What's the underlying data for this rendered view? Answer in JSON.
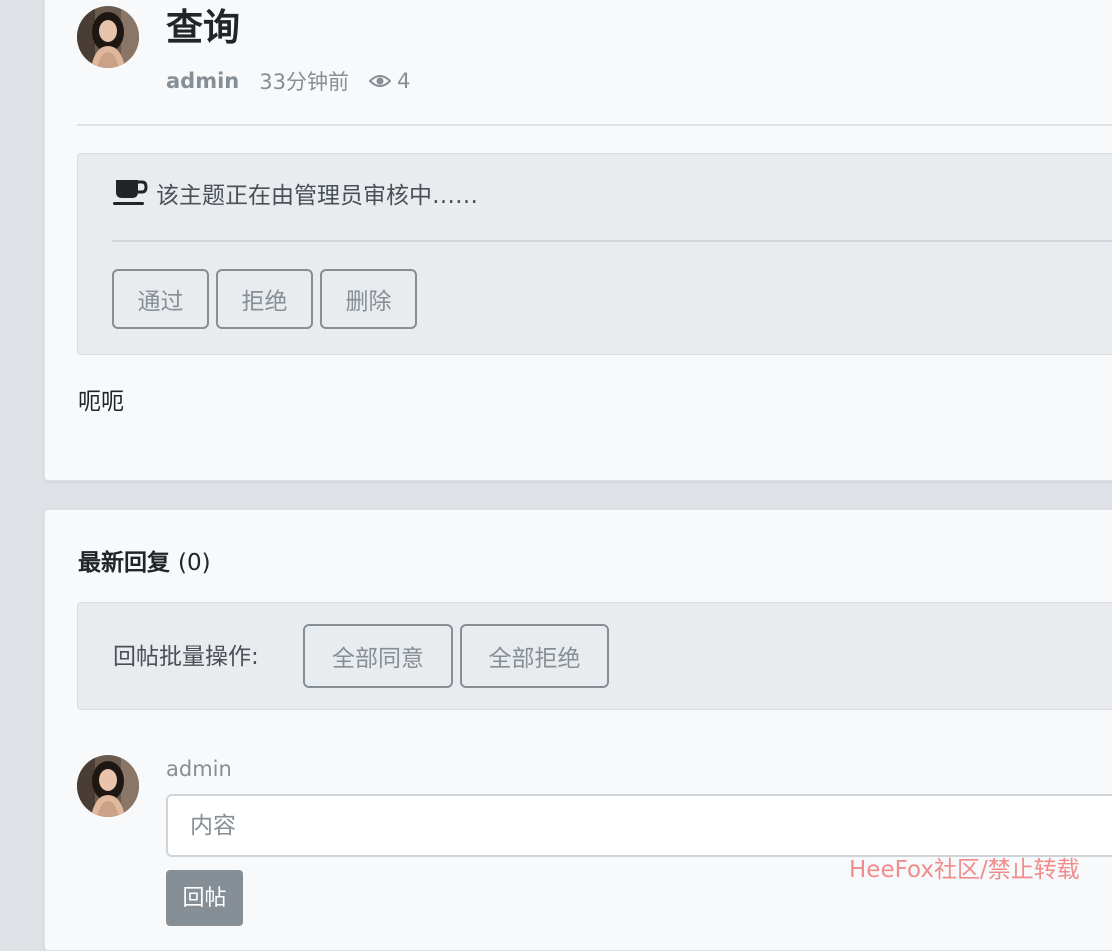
{
  "post": {
    "title": "查询",
    "author": "admin",
    "time": "33分钟前",
    "views": "4",
    "view_icon": "eye-icon",
    "notice": "该主题正在由管理员审核中……",
    "notice_icon": "coffee-cup-icon",
    "actions": {
      "approve": "通过",
      "reject": "拒绝",
      "delete": "删除"
    },
    "content": "呃呃"
  },
  "replies": {
    "heading": "最新回复",
    "count": "(0)",
    "batch_label": "回帖批量操作:",
    "batch_actions": {
      "approve_all": "全部同意",
      "reject_all": "全部拒绝"
    }
  },
  "reply_form": {
    "user": "admin",
    "placeholder": "内容",
    "value": "",
    "submit": "回帖"
  },
  "watermark": "HeeFox社区/禁止转载",
  "colors": {
    "background": "#dee2e6",
    "card": "#f8f9fa",
    "panel": "#e9ecef",
    "muted": "#868e96",
    "watermark": "#f08c8c"
  }
}
